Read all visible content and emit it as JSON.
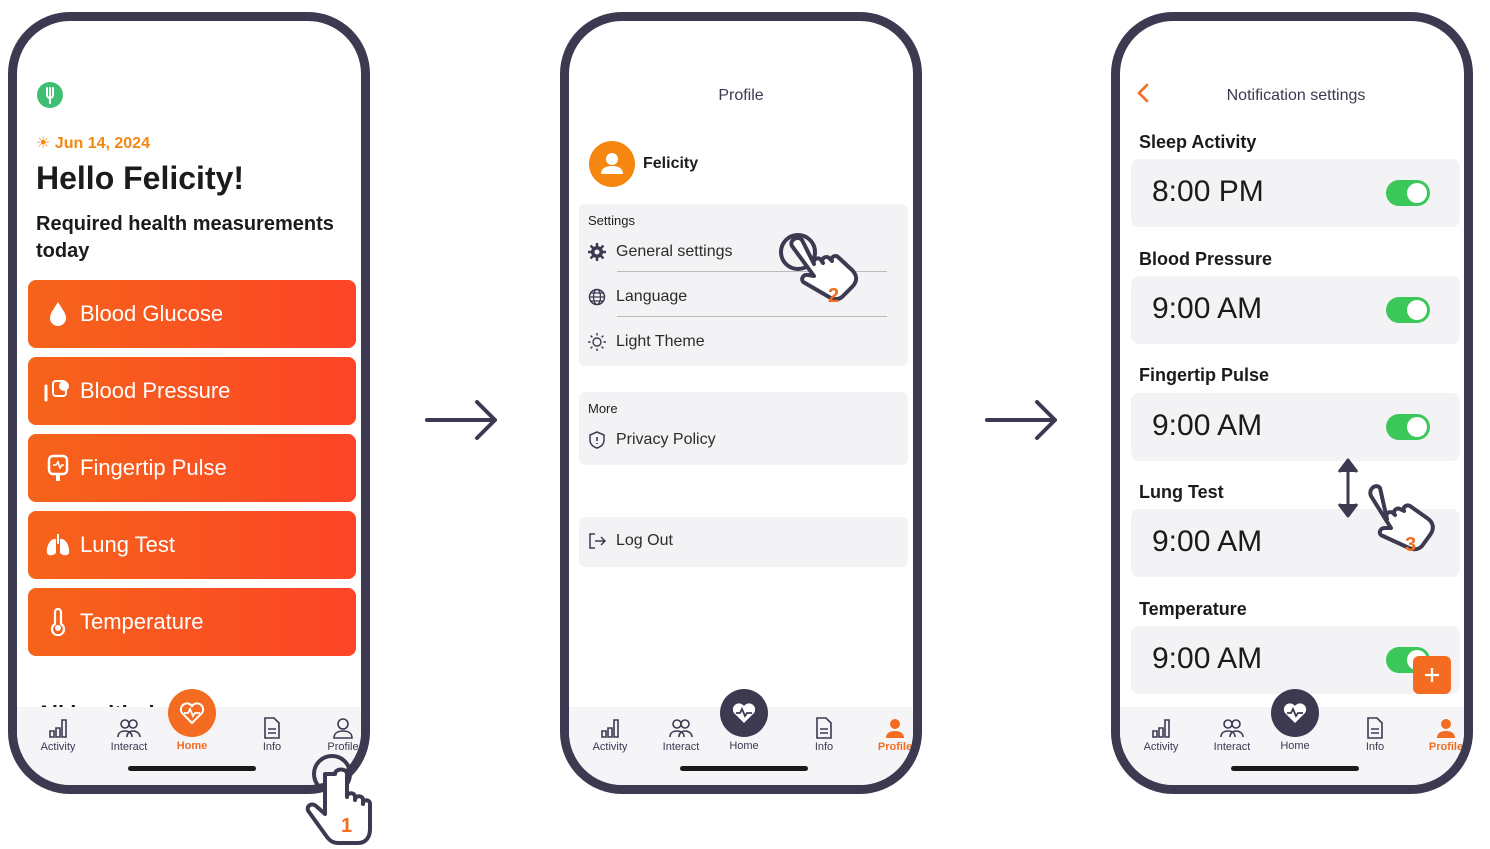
{
  "brand": {
    "accent": "#f36c21",
    "dark": "#3c3950",
    "green": "#3bc759"
  },
  "screen1": {
    "logo_icon": "leaf-fork-icon",
    "date": "Jun 14, 2024",
    "greeting": "Hello Felicity!",
    "subtitle": "Required health measurements today",
    "cards": [
      {
        "label": "Blood Glucose",
        "icon": "drop-icon"
      },
      {
        "label": "Blood Pressure",
        "icon": "blood-pressure-icon"
      },
      {
        "label": "Fingertip Pulse",
        "icon": "pulse-oximeter-icon"
      },
      {
        "label": "Lung Test",
        "icon": "lungs-icon"
      },
      {
        "label": "Temperature",
        "icon": "thermometer-icon"
      }
    ],
    "section_peek": "All health data",
    "step": "1"
  },
  "nav": {
    "activity": "Activity",
    "interact": "Interact",
    "home": "Home",
    "info": "Info",
    "profile": "Profile"
  },
  "screen2": {
    "title": "Profile",
    "user_name": "Felicity",
    "settings_title": "Settings",
    "general": "General settings",
    "language": "Language",
    "theme": "Light Theme",
    "more_title": "More",
    "privacy": "Privacy Policy",
    "logout": "Log Out",
    "step": "2"
  },
  "screen3": {
    "title": "Notification settings",
    "items": [
      {
        "label": "Sleep Activity",
        "time": "8:00 PM",
        "enabled": true
      },
      {
        "label": "Blood Pressure",
        "time": "9:00 AM",
        "enabled": true
      },
      {
        "label": "Fingertip Pulse",
        "time": "9:00 AM",
        "enabled": true
      },
      {
        "label": "Lung Test",
        "time": "9:00 AM"
      },
      {
        "label": "Temperature",
        "time": "9:00 AM",
        "enabled": true
      }
    ],
    "step": "3"
  }
}
